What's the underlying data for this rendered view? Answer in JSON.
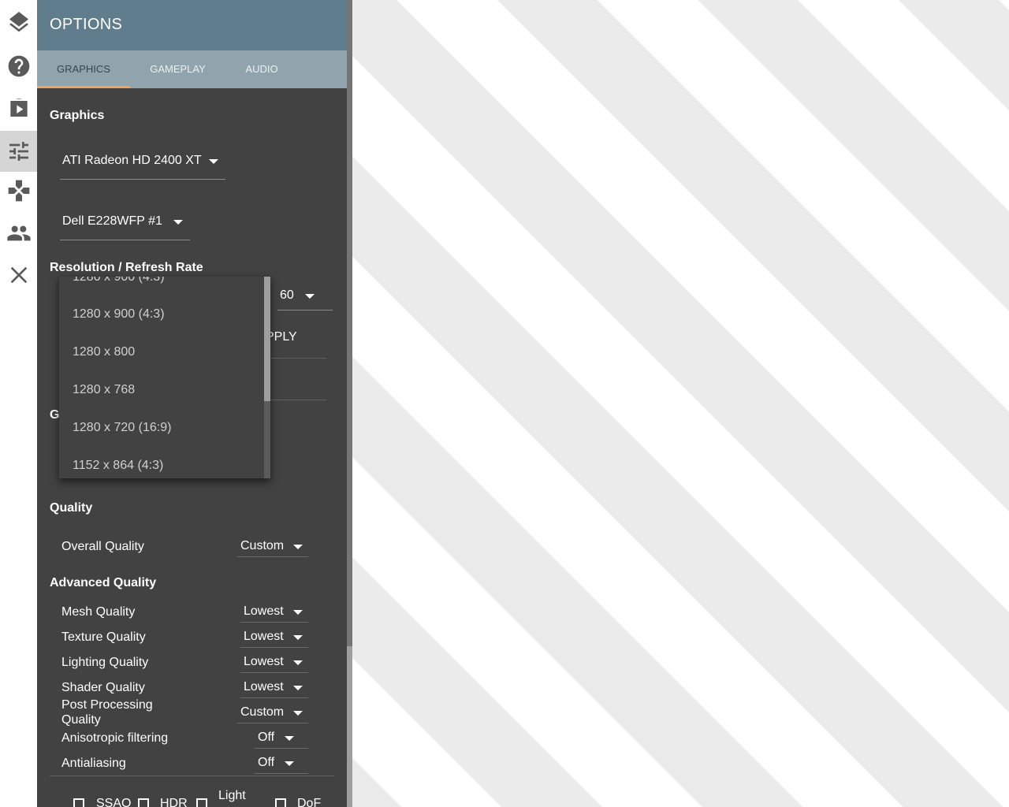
{
  "rail": {
    "items": [
      {
        "name": "layers-icon"
      },
      {
        "name": "help-icon"
      },
      {
        "name": "video-store-icon"
      },
      {
        "name": "sliders-icon",
        "active": true
      },
      {
        "name": "gamepad-icon"
      },
      {
        "name": "people-icon"
      },
      {
        "name": "close-icon"
      }
    ]
  },
  "header": {
    "title": "OPTIONS"
  },
  "tabs": [
    {
      "label": "GRAPHICS",
      "active": true
    },
    {
      "label": "GAMEPLAY",
      "active": false
    },
    {
      "label": "AUDIO",
      "active": false
    }
  ],
  "graphics": {
    "heading": "Graphics",
    "adapter": "ATI Radeon HD 2400 XT",
    "monitor": "Dell E228WFP #1"
  },
  "resolution": {
    "heading": "Resolution / Refresh Rate",
    "refresh_rate": "60",
    "apply_partial": "PPLY",
    "hidden_heading_initial": "G",
    "options": [
      "1280 x 900 (4:3)",
      "1280 x 900 (4:3)",
      "1280 x 800",
      "1280 x 768",
      "1280 x 720 (16:9)",
      "1152 x 864 (4:3)"
    ]
  },
  "quality": {
    "heading": "Quality",
    "overall_label": "Overall Quality",
    "overall_value": "Custom"
  },
  "advanced": {
    "heading": "Advanced Quality",
    "rows": [
      {
        "label": "Mesh Quality",
        "value": "Lowest"
      },
      {
        "label": "Texture Quality",
        "value": "Lowest"
      },
      {
        "label": "Lighting Quality",
        "value": "Lowest"
      },
      {
        "label": "Shader Quality",
        "value": "Lowest"
      },
      {
        "label": "Post Processing Quality",
        "value": "Custom"
      },
      {
        "label": "Anisotropic filtering",
        "value": "Off"
      },
      {
        "label": "Antialiasing",
        "value": "Off"
      }
    ]
  },
  "effects": {
    "ssao": "SSAO",
    "hdr": "HDR",
    "light": "Light",
    "dof": "DoF"
  },
  "colors": {
    "header": "#5f7d8c",
    "tabs": "#90a4ae",
    "panel": "#424242",
    "accent": "#f5a35c"
  }
}
